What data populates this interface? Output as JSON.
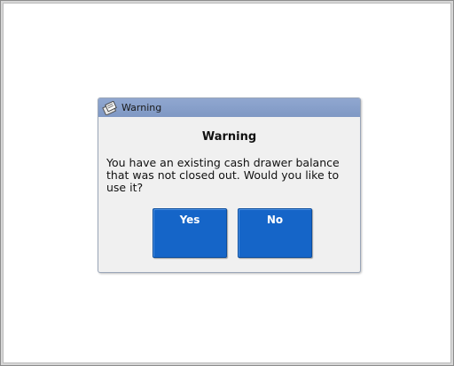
{
  "dialog": {
    "title": "Warning",
    "title_icon": "warning-dialog-icon",
    "heading": "Warning",
    "message": "You have an existing cash drawer balance that was not closed out. Would you like to use it?",
    "buttons": {
      "yes_label": "Yes",
      "no_label": "No"
    }
  },
  "colors": {
    "titlebar": "#8aa2cc",
    "button": "#1565c8",
    "dialog_background": "#f0f0f0"
  }
}
